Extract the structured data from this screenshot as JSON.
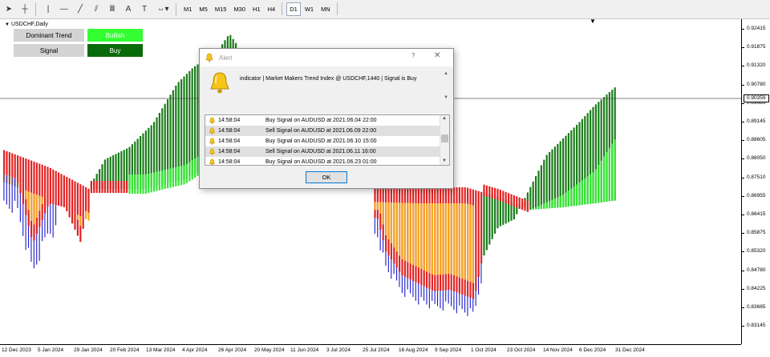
{
  "toolbar": {
    "icons": [
      "cursor-icon",
      "crosshair-icon",
      "vertical-line-icon",
      "horizontal-line-icon",
      "trendline-icon",
      "channel-icon",
      "fibonacci-icon",
      "text-icon",
      "text-label-icon",
      "shapes-icon"
    ],
    "icon_glyphs": {
      "cursor": "➤",
      "crosshair": "┼",
      "vline": "|",
      "hline": "—",
      "trend": "╱",
      "channel": "⫽",
      "fibo": "Ⅲ",
      "text": "A",
      "label": "T",
      "shapes": "⇔▾"
    },
    "timeframes": [
      "M1",
      "M5",
      "M15",
      "M30",
      "H1",
      "H4",
      "D1",
      "W1",
      "MN"
    ],
    "active_timeframe": "D1"
  },
  "chart": {
    "title": "USDCHF,Daily",
    "current_price": "0.90359",
    "price_labels": [
      "0.92415",
      "0.91875",
      "0.91320",
      "0.90780",
      "0.89685",
      "0.89145",
      "0.88605",
      "0.88050",
      "0.87510",
      "0.86955",
      "0.86415",
      "0.85875",
      "0.85320",
      "0.84780",
      "0.84225",
      "0.83685",
      "0.83145"
    ],
    "time_labels": [
      "12 Dec 2023",
      "5 Jan 2024",
      "29 Jan 2024",
      "20 Feb 2024",
      "13 Mar 2024",
      "4 Apr 2024",
      "26 Apr 2024",
      "20 May 2024",
      "11 Jun 2024",
      "3 Jul 2024",
      "25 Jul 2024",
      "16 Aug 2024",
      "9 Sep 2024",
      "1 Oct 2024",
      "23 Oct 2024",
      "14 Nov 2024",
      "6 Dec 2024",
      "31 Dec 2024"
    ],
    "colors": {
      "bull_strong": "#1b7d1b",
      "bull_light": "#33e633",
      "bear": "#e22222",
      "bear_light": "#f5a623",
      "wick": "#1a1acc",
      "axis": "#000000"
    }
  },
  "panel": {
    "rows": [
      {
        "label": "Dominant Trend",
        "value": "Bullish",
        "color": "#33ff33"
      },
      {
        "label": "Signal",
        "value": "Buy",
        "color": "#0a6b0a"
      }
    ]
  },
  "alert": {
    "title": "Alert",
    "help": "?",
    "close": "✕",
    "message": "indicator | Market Makers Trend Index @ USDCHF,1440 | Signal is Buy",
    "rows": [
      {
        "time": "14:58:04",
        "message": "Buy Signal on AUDUSD at 2021.06.04 22:00"
      },
      {
        "time": "14:58:04",
        "message": "Sell Signal on AUDUSD at 2021.06.09 22:00"
      },
      {
        "time": "14:58:04",
        "message": "Buy Signal on AUDUSD at 2021.06.10 15:00"
      },
      {
        "time": "14:58:04",
        "message": "Sell Signal on AUDUSD at 2021.06.11 16:00"
      },
      {
        "time": "14:58:04",
        "message": "Buy Signal on AUDUSD at 2021.06.23 01:00"
      }
    ],
    "ok_label": "OK"
  }
}
